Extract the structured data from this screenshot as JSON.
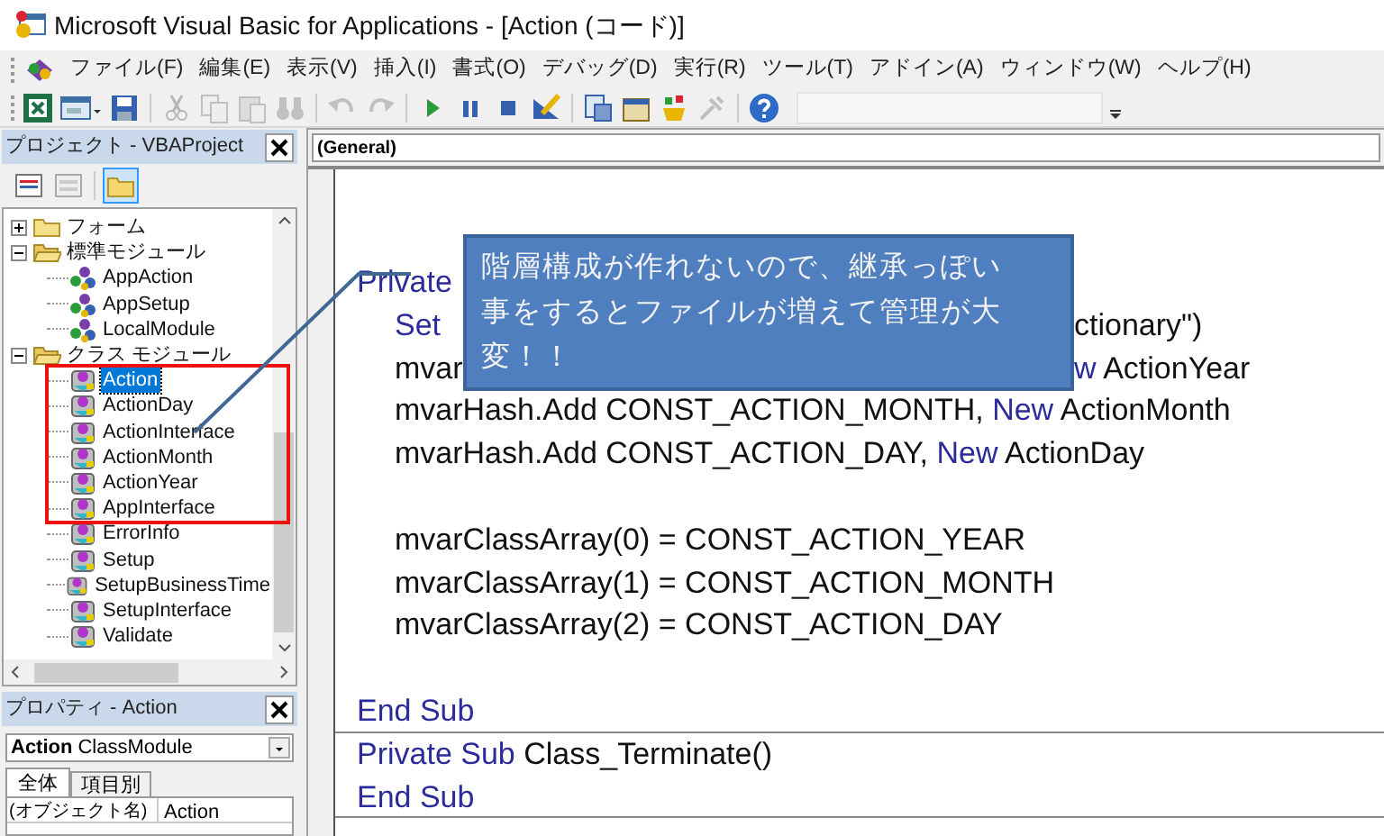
{
  "window": {
    "title": "Microsoft Visual Basic for Applications - [Action (コード)]"
  },
  "menu": [
    "ファイル(F)",
    "編集(E)",
    "表示(V)",
    "挿入(I)",
    "書式(O)",
    "デバッグ(D)",
    "実行(R)",
    "ツール(T)",
    "アドイン(A)",
    "ウィンドウ(W)",
    "ヘルプ(H)"
  ],
  "toolbar": [
    {
      "kind": "excel",
      "disabled": false
    },
    {
      "kind": "form",
      "disabled": false
    },
    {
      "kind": "save",
      "disabled": false
    },
    {
      "kind": "sep"
    },
    {
      "kind": "cut",
      "disabled": true
    },
    {
      "kind": "copy",
      "disabled": true
    },
    {
      "kind": "paste",
      "disabled": true
    },
    {
      "kind": "find",
      "disabled": true
    },
    {
      "kind": "sep"
    },
    {
      "kind": "undo",
      "disabled": true
    },
    {
      "kind": "redo",
      "disabled": true
    },
    {
      "kind": "sep"
    },
    {
      "kind": "run",
      "disabled": false
    },
    {
      "kind": "pause",
      "disabled": false
    },
    {
      "kind": "stop",
      "disabled": false
    },
    {
      "kind": "design",
      "disabled": false
    },
    {
      "kind": "sep"
    },
    {
      "kind": "project",
      "disabled": false
    },
    {
      "kind": "properties",
      "disabled": false
    },
    {
      "kind": "browser",
      "disabled": false
    },
    {
      "kind": "toolbox",
      "disabled": true
    },
    {
      "kind": "sep"
    },
    {
      "kind": "help",
      "disabled": false
    }
  ],
  "project": {
    "title": "プロジェクト - VBAProject",
    "toolbar": [
      {
        "kind": "view-code",
        "selected": false
      },
      {
        "kind": "view-object",
        "selected": false
      },
      {
        "kind": "toggle-folders",
        "selected": true
      }
    ],
    "tree": [
      {
        "label": "フォーム",
        "kind": "folder",
        "expanded": false,
        "selected": false
      },
      {
        "label": "標準モジュール",
        "kind": "folder",
        "expanded": true,
        "selected": false,
        "children": [
          {
            "label": "AppAction",
            "kind": "module",
            "selected": false
          },
          {
            "label": "AppSetup",
            "kind": "module",
            "selected": false
          },
          {
            "label": "LocalModule",
            "kind": "module",
            "selected": false
          }
        ]
      },
      {
        "label": "クラス モジュール",
        "kind": "folder",
        "expanded": true,
        "selected": false,
        "children": [
          {
            "label": "Action",
            "kind": "class",
            "selected": true
          },
          {
            "label": "ActionDay",
            "kind": "class",
            "selected": false
          },
          {
            "label": "ActionInterface",
            "kind": "class",
            "selected": false
          },
          {
            "label": "ActionMonth",
            "kind": "class",
            "selected": false
          },
          {
            "label": "ActionYear",
            "kind": "class",
            "selected": false
          },
          {
            "label": "AppInterface",
            "kind": "class",
            "selected": false
          },
          {
            "label": "ErrorInfo",
            "kind": "class",
            "selected": false
          },
          {
            "label": "Setup",
            "kind": "class",
            "selected": false
          },
          {
            "label": "SetupBusinessTime",
            "kind": "class",
            "selected": false
          },
          {
            "label": "SetupInterface",
            "kind": "class",
            "selected": false
          },
          {
            "label": "Validate",
            "kind": "class",
            "selected": false
          }
        ]
      }
    ]
  },
  "properties": {
    "title": "プロパティ - Action",
    "object_name": "Action",
    "object_type": "ClassModule",
    "tabs": [
      {
        "label": "全体",
        "selected": true
      },
      {
        "label": "項目別",
        "selected": false
      }
    ],
    "rows": [
      {
        "name": "(オブジェクト名)",
        "value": "Action"
      }
    ]
  },
  "code": {
    "object": "(General)",
    "lines": [
      {
        "indented": false,
        "tokens": [
          {
            "text": "Private",
            "kind": "keyword"
          }
        ]
      },
      {
        "indented": true,
        "tokens": [
          {
            "text": "Set",
            "kind": "keyword"
          }
        ],
        "right": [
          {
            "text": "ctionary\")",
            "kind": "plain"
          }
        ]
      },
      {
        "indented": true,
        "tokens": [
          {
            "text": "mvar",
            "kind": "plain"
          }
        ],
        "right": [
          {
            "text": "w",
            "kind": "keyword"
          },
          {
            "text": " ActionYear",
            "kind": "plain"
          }
        ]
      },
      {
        "indented": true,
        "tokens": [
          {
            "text": "mvarHash.Add CONST_ACTION_MONTH, ",
            "kind": "plain"
          },
          {
            "text": "New",
            "kind": "keyword"
          },
          {
            "text": " ActionMonth",
            "kind": "plain"
          }
        ]
      },
      {
        "indented": true,
        "tokens": [
          {
            "text": "mvarHash.Add CONST_ACTION_DAY, ",
            "kind": "plain"
          },
          {
            "text": "New",
            "kind": "keyword"
          },
          {
            "text": " ActionDay",
            "kind": "plain"
          }
        ]
      },
      {
        "indented": true,
        "gap_before": true,
        "tokens": [
          {
            "text": "mvarClassArray(0) = CONST_ACTION_YEAR",
            "kind": "plain"
          }
        ]
      },
      {
        "indented": true,
        "tokens": [
          {
            "text": "mvarClassArray(1) = CONST_ACTION_MONTH",
            "kind": "plain"
          }
        ]
      },
      {
        "indented": true,
        "tokens": [
          {
            "text": "mvarClassArray(2) = CONST_ACTION_DAY",
            "kind": "plain"
          }
        ]
      },
      {
        "indented": false,
        "gap_before": true,
        "separator_after": true,
        "tokens": [
          {
            "text": "End Sub",
            "kind": "keyword"
          }
        ]
      },
      {
        "indented": false,
        "tokens": [
          {
            "text": "Private Sub",
            "kind": "keyword"
          },
          {
            "text": " Class_Terminate()",
            "kind": "plain"
          }
        ]
      },
      {
        "indented": false,
        "separator_after": true,
        "tokens": [
          {
            "text": "End Sub",
            "kind": "keyword"
          }
        ]
      }
    ]
  },
  "callout": {
    "lines": [
      "階層構成が作れないので、継承っぽい",
      "事をするとファイルが増えて管理が大",
      "変！！"
    ]
  }
}
